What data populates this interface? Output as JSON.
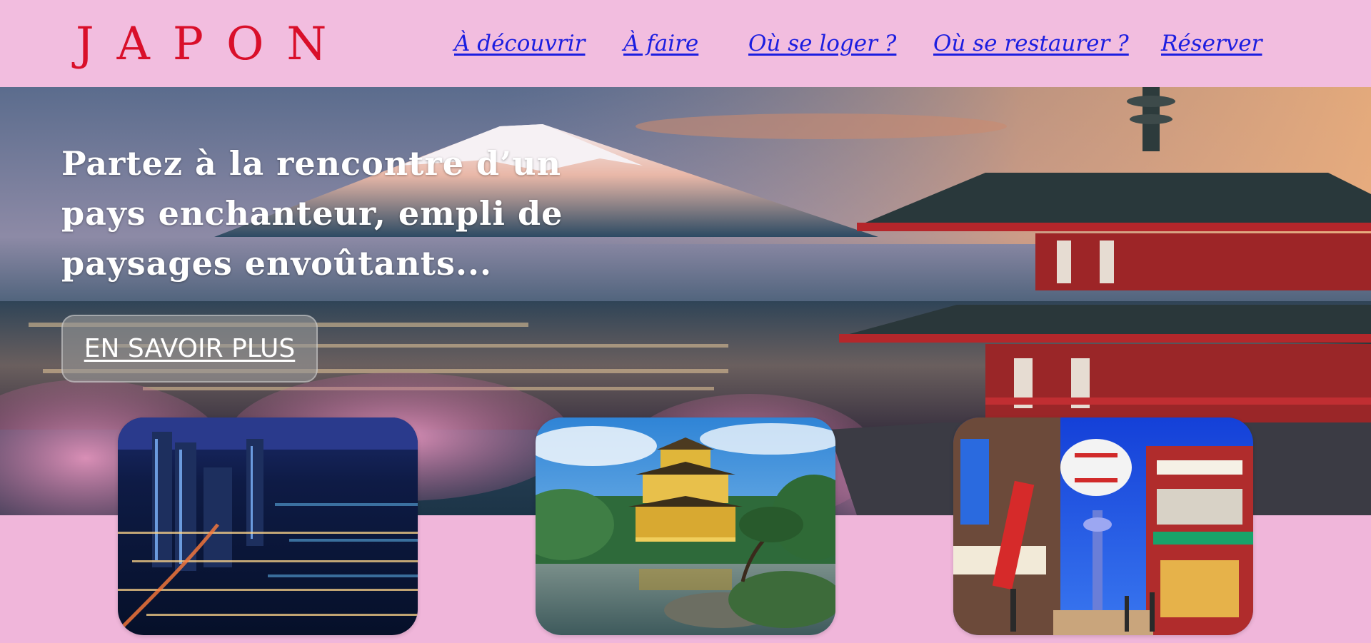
{
  "header": {
    "logo": "JAPON",
    "nav": [
      {
        "label": "À découvrir"
      },
      {
        "label": "À faire"
      },
      {
        "label": "Où se loger ?"
      },
      {
        "label": "Où se restaurer ?"
      },
      {
        "label": "Réserver"
      }
    ]
  },
  "hero": {
    "title": "Partez à la rencontre d’un pays enchanteur, empli de paysages envoûtants...",
    "button_label": "EN SAVOIR PLUS"
  },
  "cards": [
    {
      "image": "tokyo-night-skyline"
    },
    {
      "image": "golden-pavilion-kinkaku-ji"
    },
    {
      "image": "osaka-shinsekai-street"
    }
  ],
  "colors": {
    "background": "#f0b6da",
    "logo": "#d90f2a",
    "nav_link": "#1c1ee0",
    "hero_text": "#ffffff"
  }
}
